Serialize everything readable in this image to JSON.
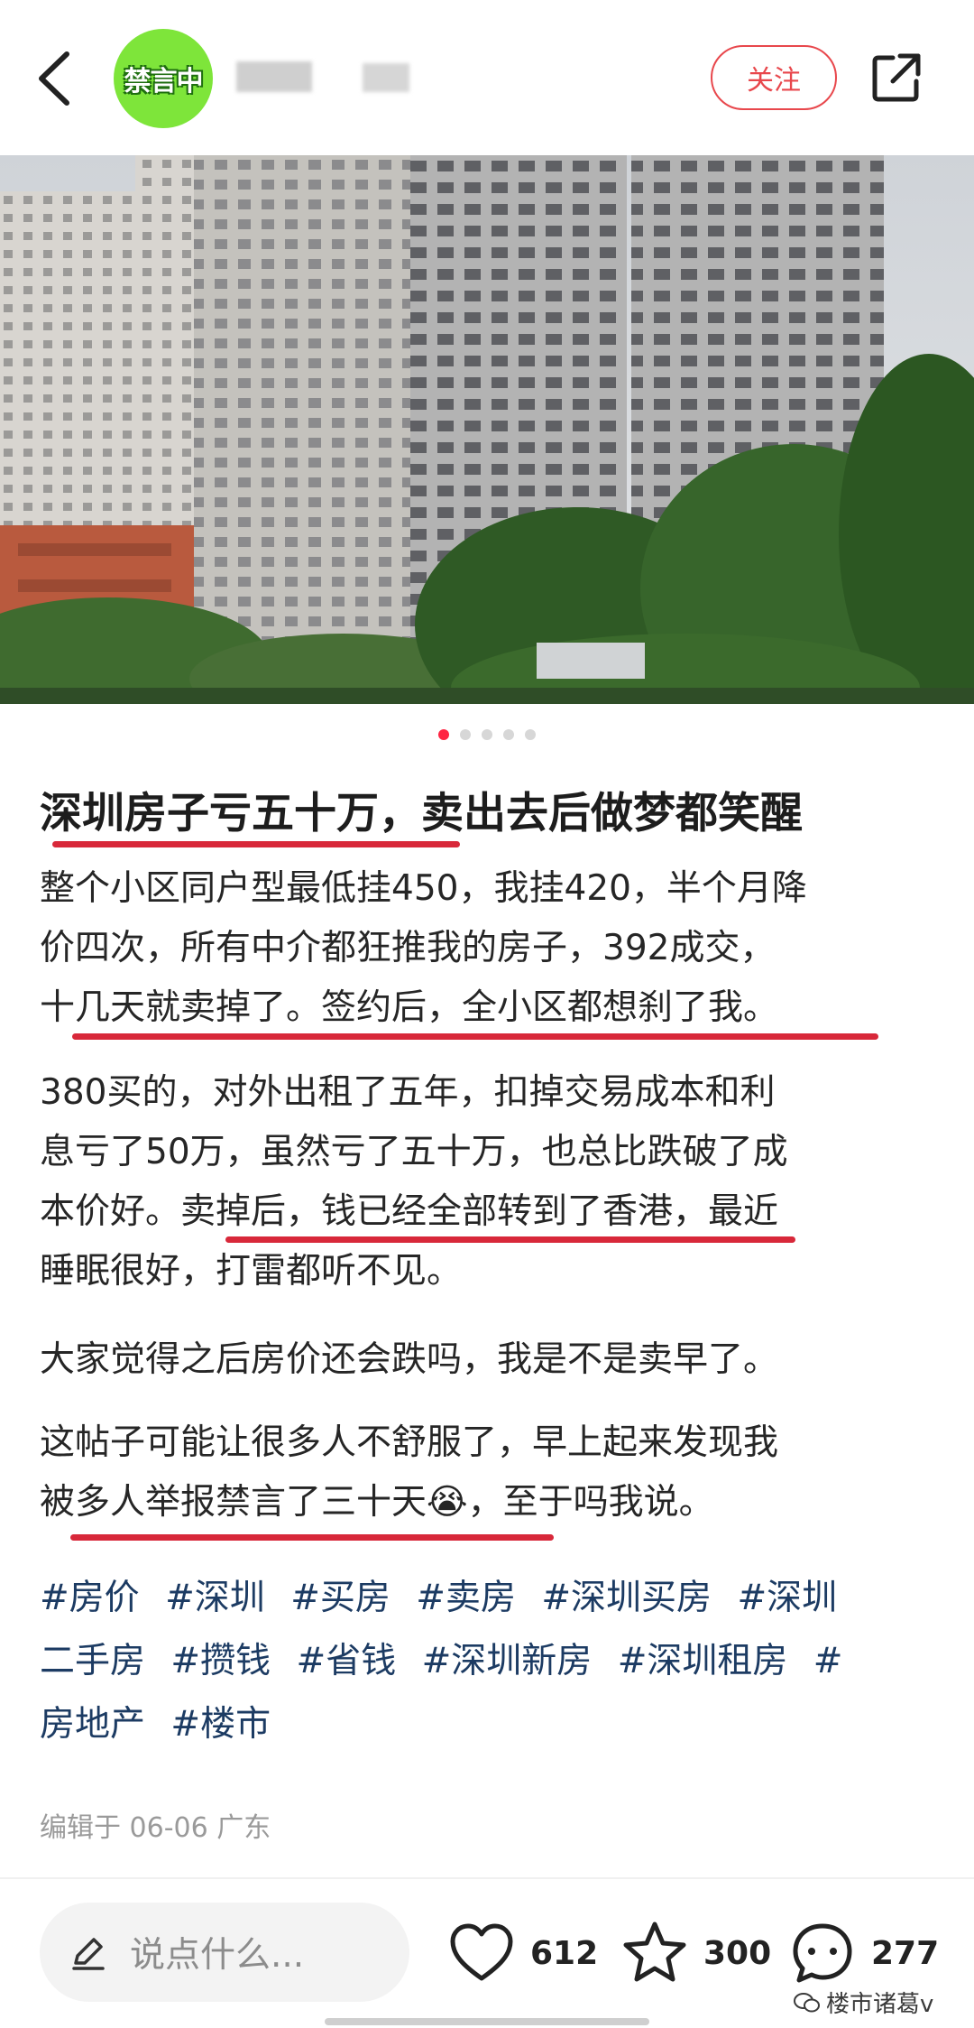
{
  "header": {
    "avatar_badge": "禁言中",
    "follow_label": "关注"
  },
  "gallery": {
    "slide_count": 5,
    "active_index": 0
  },
  "post": {
    "title": "深圳房子亏五十万，卖出去后做梦都笑醒",
    "paragraphs": [
      [
        "整个小区同户型最低挂450，我挂420，半个月降",
        "价四次，所有中介都狂推我的房子，392成交，",
        "十几天就卖掉了。签约后，全小区都想刹了我。"
      ],
      [
        "380买的，对外出租了五年，扣掉交易成本和利",
        "息亏了50万，虽然亏了五十万，也总比跌破了成",
        "本价好。卖掉后，钱已经全部转到了香港，最近",
        "睡眠很好，打雷都听不见。"
      ],
      [
        "大家觉得之后房价还会跌吗，我是不是卖早了。"
      ],
      [
        "这帖子可能让很多人不舒服了，早上起来发现我",
        "被多人举报禁言了三十天😭，至于吗我说。"
      ]
    ],
    "tags": [
      "#房价",
      "#深圳",
      "#买房",
      "#卖房",
      "#深圳买房",
      "#深圳",
      "二手房",
      "#攒钱",
      "#省钱",
      "#深圳新房",
      "#深圳租房",
      "#",
      "房地产",
      "#楼市"
    ],
    "meta": "编辑于 06-06 广东"
  },
  "bottom_bar": {
    "comment_placeholder": "说点什么...",
    "like_count": "612",
    "star_count": "300",
    "comment_count": "277",
    "watermark": "楼市诸葛v"
  },
  "colors": {
    "accent": "#ff2442",
    "underline": "#d8283a",
    "tag": "#1c3b63",
    "avatar": "#7ee53a"
  }
}
